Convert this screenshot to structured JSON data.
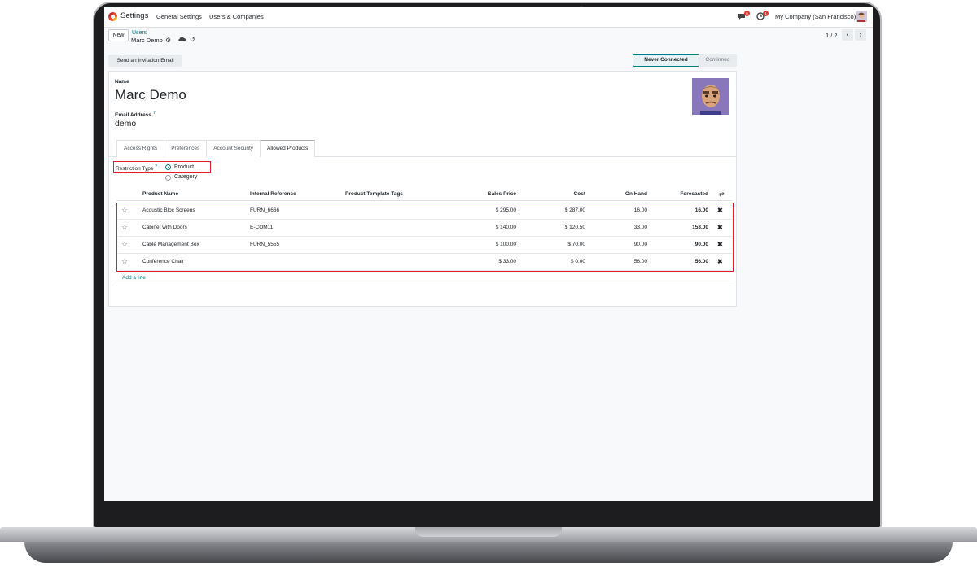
{
  "navbar": {
    "app_name": "Settings",
    "menu_general": "General Settings",
    "menu_users": "Users & Companies",
    "chat_badge": "6",
    "activity_badge": "1",
    "company": "My Company (San Francisco)"
  },
  "control_panel": {
    "new_label": "New",
    "breadcrumb_parent": "Users",
    "breadcrumb_current": "Marc Demo",
    "pager": "1 / 2"
  },
  "status_bar": {
    "invite_button": "Send an Invitation Email",
    "states": [
      "Never Connected",
      "Confirmed"
    ],
    "active_state": "Never Connected"
  },
  "form": {
    "name_label": "Name",
    "name_value": "Marc Demo",
    "email_label": "Email Address",
    "email_help": "?",
    "email_value": "demo"
  },
  "tabs": [
    "Access Rights",
    "Preferences",
    "Account Security",
    "Allowed Products"
  ],
  "active_tab": "Allowed Products",
  "restriction": {
    "label": "Restriction Type",
    "help": "?",
    "options": [
      "Product",
      "Category"
    ],
    "selected": "Product"
  },
  "table": {
    "headers": [
      "Product Name",
      "Internal Reference",
      "Product Template Tags",
      "Sales Price",
      "Cost",
      "On Hand",
      "Forecasted"
    ],
    "rows": [
      {
        "name": "Acoustic Bloc Screens",
        "ref": "FURN_6666",
        "tags": "",
        "sales_price": "$ 295.00",
        "cost": "$ 287.00",
        "on_hand": "16.00",
        "forecasted": "16.00"
      },
      {
        "name": "Cabinet with Doors",
        "ref": "E-COM11",
        "tags": "",
        "sales_price": "$ 140.00",
        "cost": "$ 120.50",
        "on_hand": "33.00",
        "forecasted": "153.00"
      },
      {
        "name": "Cable Management Box",
        "ref": "FURN_5555",
        "tags": "",
        "sales_price": "$ 100.00",
        "cost": "$ 70.00",
        "on_hand": "90.00",
        "forecasted": "90.00"
      },
      {
        "name": "Conference Chair",
        "ref": "",
        "tags": "",
        "sales_price": "$ 33.00",
        "cost": "$ 0.00",
        "on_hand": "56.00",
        "forecasted": "56.00"
      }
    ],
    "add_line": "Add a line"
  },
  "colors": {
    "accent": "#017e84",
    "highlight": "#e0202f"
  }
}
